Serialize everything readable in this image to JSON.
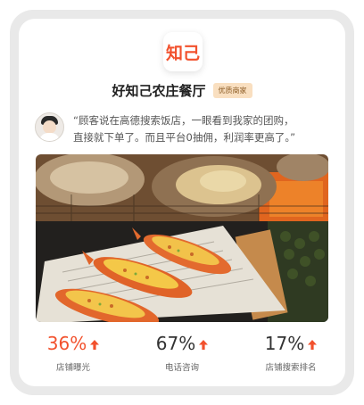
{
  "logo": {
    "text": "知己"
  },
  "shop": {
    "name": "好知己农庄餐厅",
    "badge": "优质商家"
  },
  "quote": {
    "line1": "“顾客说在高德搜索饭店，一眼看到我家的团购，",
    "line2": "直接就下单了。而且平台0抽佣，利润率更高了。”"
  },
  "photo": {
    "icon": "grilled-shrimp-photo"
  },
  "stats": [
    {
      "value": "36%",
      "label": "店铺曝光",
      "icon": "arrow-up-icon"
    },
    {
      "value": "67%",
      "label": "电话咨询",
      "icon": "arrow-up-icon"
    },
    {
      "value": "17%",
      "label": "店铺搜索排名",
      "icon": "arrow-up-icon"
    }
  ],
  "colors": {
    "accent": "#f2512d",
    "badge_bg": "#f9dfc0",
    "frame": "#e9e9e9"
  }
}
